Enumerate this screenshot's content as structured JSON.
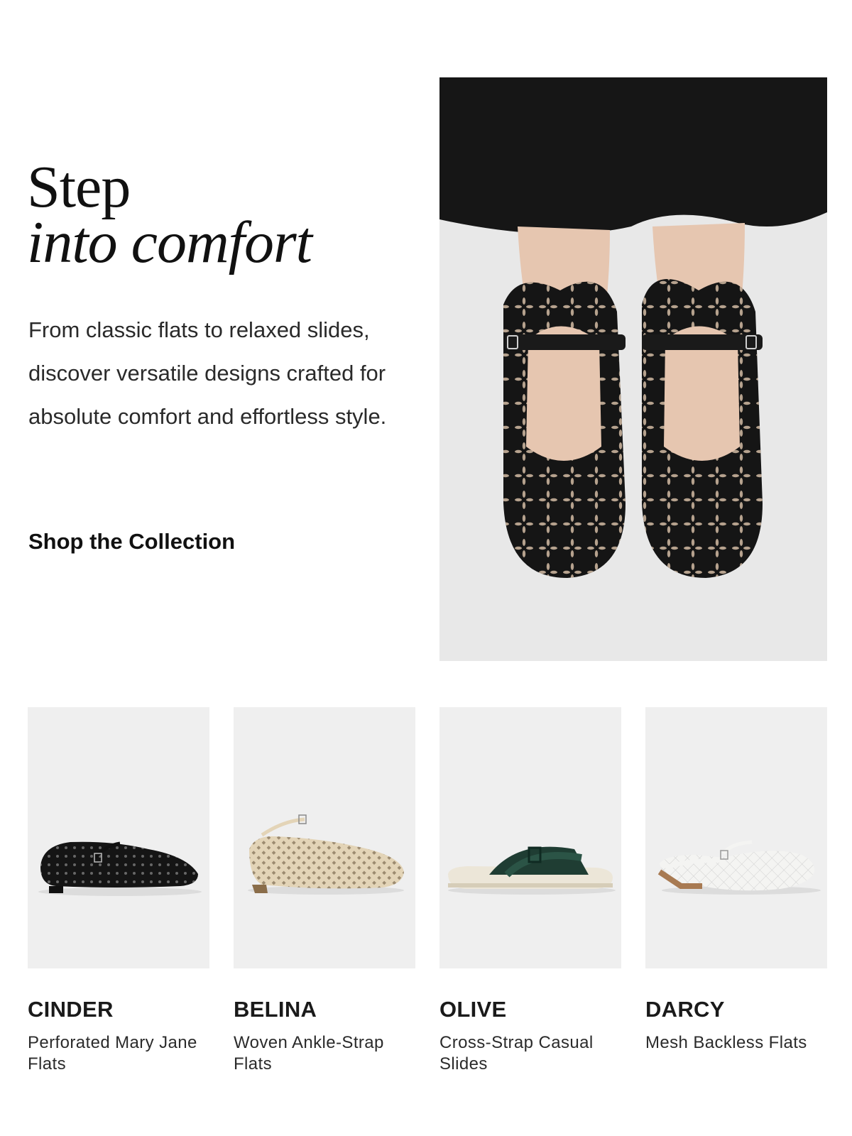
{
  "hero": {
    "title_line1": "Step",
    "title_line2": "into comfort",
    "description": "From classic flats to relaxed slides, discover versatile designs crafted for absolute comfort and effortless style.",
    "cta_label": "Shop the Collection"
  },
  "products": [
    {
      "name": "CINDER",
      "description": "Perforated Mary Jane Flats"
    },
    {
      "name": "BELINA",
      "description": "Woven Ankle-Strap Flats"
    },
    {
      "name": "OLIVE",
      "description": "Cross-Strap Casual Slides"
    },
    {
      "name": "DARCY",
      "description": "Mesh Backless Flats"
    }
  ],
  "colors": {
    "text": "#1a1a1a",
    "thumb_bg": "#efefef",
    "hero_floor": "#e9e9e9",
    "shoe_black": "#151515",
    "shoe_beige": "#e3d4b7",
    "strap_green": "#1f3d33",
    "mesh_white": "#f4f4f2"
  }
}
